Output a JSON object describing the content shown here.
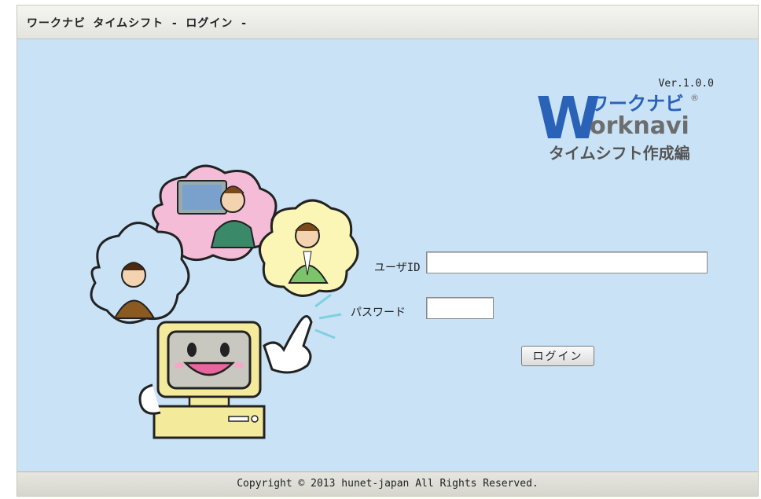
{
  "window": {
    "title": "ワークナビ  タイムシフト - ログイン -"
  },
  "header": {
    "version": "Ver.1.0.0"
  },
  "logo": {
    "line1": "ワークナビ",
    "line2": "orknavi",
    "line3": "タイムシフト作成編",
    "mark": "W",
    "registered": "®"
  },
  "form": {
    "userid_label": "ユーザID",
    "userid_value": "",
    "password_label": "パスワード",
    "password_value": "",
    "login_label": "ログイン"
  },
  "footer": {
    "copyright": "Copyright © 2013 hunet-japan All Rights Reserved."
  },
  "colors": {
    "background": "#c9e2f6",
    "logo_blue": "#2a62b8",
    "logo_gray": "#6d6d6d"
  }
}
